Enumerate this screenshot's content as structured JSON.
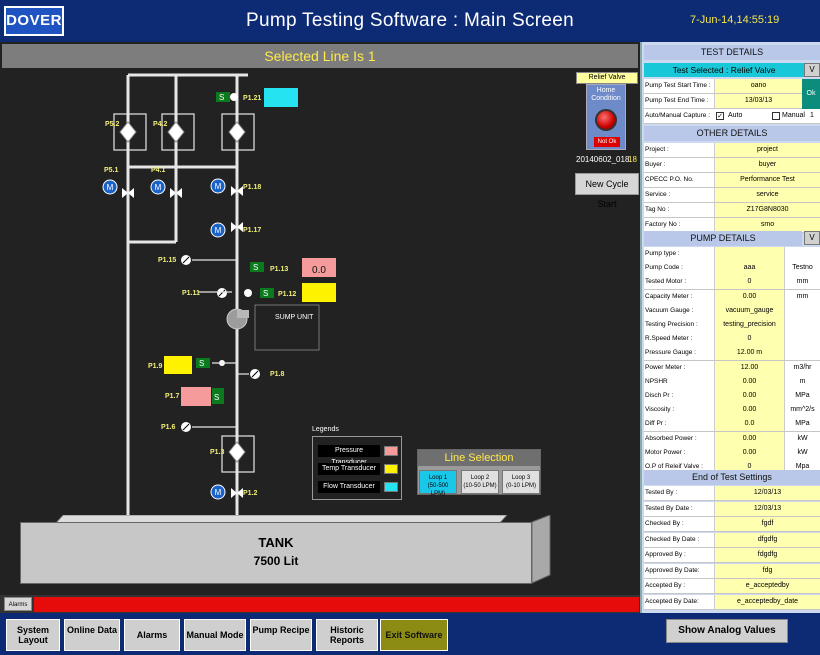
{
  "header": {
    "logo": "DOVER",
    "title": "Pump Testing Software : Main Screen",
    "datetime": "7-Jun-14,14:55:19"
  },
  "canvas": {
    "selected_line": "Selected Line Is 1",
    "labels": {
      "p5_2": "P5.2",
      "p4_2": "P4.2",
      "p1_21": "P1.21",
      "p5_1": "P5.1",
      "p4_1": "P4.1",
      "p1_18": "P1.18",
      "p1_17": "P1.17",
      "p1_15": "P1.15",
      "p1_13": "P1.13",
      "p1_11": "P1.11",
      "p1_12": "P1.12",
      "sump_unit": "SUMP UNIT",
      "p1_9": "P1.9",
      "p1_8": "P1.8",
      "p1_7": "P1.7",
      "p1_6": "P1.6",
      "p1_3": "P1.3",
      "p1_2": "P1.2"
    },
    "readouts": {
      "p1_13_value": "0.0"
    },
    "relief_valve": {
      "title": "Relief Valve",
      "home_condition": "Home Condition",
      "status": "Not Ok",
      "cycle_id": "20140602_018",
      "cycle_num": "18"
    },
    "new_cycle_label": "New Cycle Start",
    "legends": {
      "title": "Legends",
      "items": [
        {
          "label": "Pressure Transducer",
          "color": "#f59b9b"
        },
        {
          "label": "Temp Transducer",
          "color": "#fff200"
        },
        {
          "label": "Flow Transducer",
          "color": "#26e3f2"
        }
      ]
    },
    "line_selection": {
      "title": "Line Selection",
      "loops": [
        {
          "name": "Loop 1",
          "range": "(50-500 LPM)"
        },
        {
          "name": "Loop 2",
          "range": "(10-50 LPM)"
        },
        {
          "name": "Loop 3",
          "range": "(0-10 LPM)"
        }
      ]
    },
    "tank": {
      "title": "TANK",
      "capacity": "7500 Lit"
    },
    "alarms_label": "Alarms"
  },
  "test_details": {
    "title": "TEST DETAILS",
    "test_selected": "Test Selected : Relief Valve",
    "dropdown_btn": "V",
    "ok_btn": "Ok",
    "start_time_label": "Pump Test Start Time :",
    "start_time_value": "oano",
    "end_time_label": "Pump Test End Time :",
    "end_time_value": "13/03/13",
    "capture_label": "Auto/Manual Capture :",
    "auto_label": "Auto",
    "manual_label": "Manual",
    "manual_count": "1"
  },
  "other_details": {
    "title": "OTHER DETAILS",
    "rows": [
      {
        "label": "Project :",
        "value": "project"
      },
      {
        "label": "Buyer :",
        "value": "buyer"
      },
      {
        "label": "CPECC P.O. No.",
        "value": "Performance Test"
      },
      {
        "label": "Service :",
        "value": "service"
      },
      {
        "label": "Tag No :",
        "value": "Z17G8N8030"
      },
      {
        "label": "Factory No :",
        "value": "smo"
      }
    ]
  },
  "pump_details": {
    "title": "PUMP DETAILS",
    "dropdown_btn": "V",
    "rows": [
      {
        "label": "Pump type :",
        "value": "",
        "unit": ""
      },
      {
        "label": "Pump Code :",
        "value": "aaa",
        "unit": "Testno"
      },
      {
        "label": "Tested Motor :",
        "value": "0",
        "unit": "mm"
      },
      {
        "label": "Capacity Meter :",
        "value": "0.00",
        "unit": "mm"
      },
      {
        "label": "Vacuum Gauge :",
        "value": "vacuum_gauge",
        "unit": ""
      },
      {
        "label": "Testing Precision :",
        "value": "testing_precision",
        "unit": ""
      },
      {
        "label": "R.Speed Meter :",
        "value": "0",
        "unit": ""
      },
      {
        "label": "Pressure Gauge :",
        "value": "12.00 m",
        "unit": ""
      },
      {
        "label": "Power Meter :",
        "value": "12.00",
        "unit": "m3/hr"
      },
      {
        "label": "NPSHR",
        "value": "0.00",
        "unit": "m"
      },
      {
        "label": "Disch Pr :",
        "value": "0.00",
        "unit": "MPa"
      },
      {
        "label": "Viscosity :",
        "value": "0.00",
        "unit": "mm^2/s"
      },
      {
        "label": "Diff Pr :",
        "value": "0.0",
        "unit": "MPa"
      },
      {
        "label": "Absorbed Power :",
        "value": "0.00",
        "unit": "kW"
      },
      {
        "label": "Motor Power :",
        "value": "0.00",
        "unit": "kW"
      },
      {
        "label": "O.P of Releif Valve :",
        "value": "0",
        "unit": "Mpa"
      }
    ]
  },
  "end_settings": {
    "title": "End of Test Settings",
    "rows": [
      {
        "label": "Tested By :",
        "value": "12/03/13"
      },
      {
        "label": "Tested By Date :",
        "value": "12/03/13"
      },
      {
        "label": "Checked By :",
        "value": "fgdf"
      },
      {
        "label": "Checked By Date :",
        "value": "dfgdfg"
      },
      {
        "label": "Approved By :",
        "value": "fdgdfg"
      },
      {
        "label": "Approved By Date:",
        "value": "fdg"
      },
      {
        "label": "Accepted By :",
        "value": "e_acceptedby"
      },
      {
        "label": "Accepted By Date:",
        "value": "e_acceptedby_date"
      }
    ]
  },
  "nav": {
    "system_layout": "System Layout",
    "online_data": "Online Data",
    "alarms": "Alarms",
    "manual_mode": "Manual Mode",
    "pump_recipe": "Pump Recipe",
    "historic_reports": "Historic Reports",
    "exit_software": "Exit Software",
    "show_analog": "Show Analog Values"
  }
}
